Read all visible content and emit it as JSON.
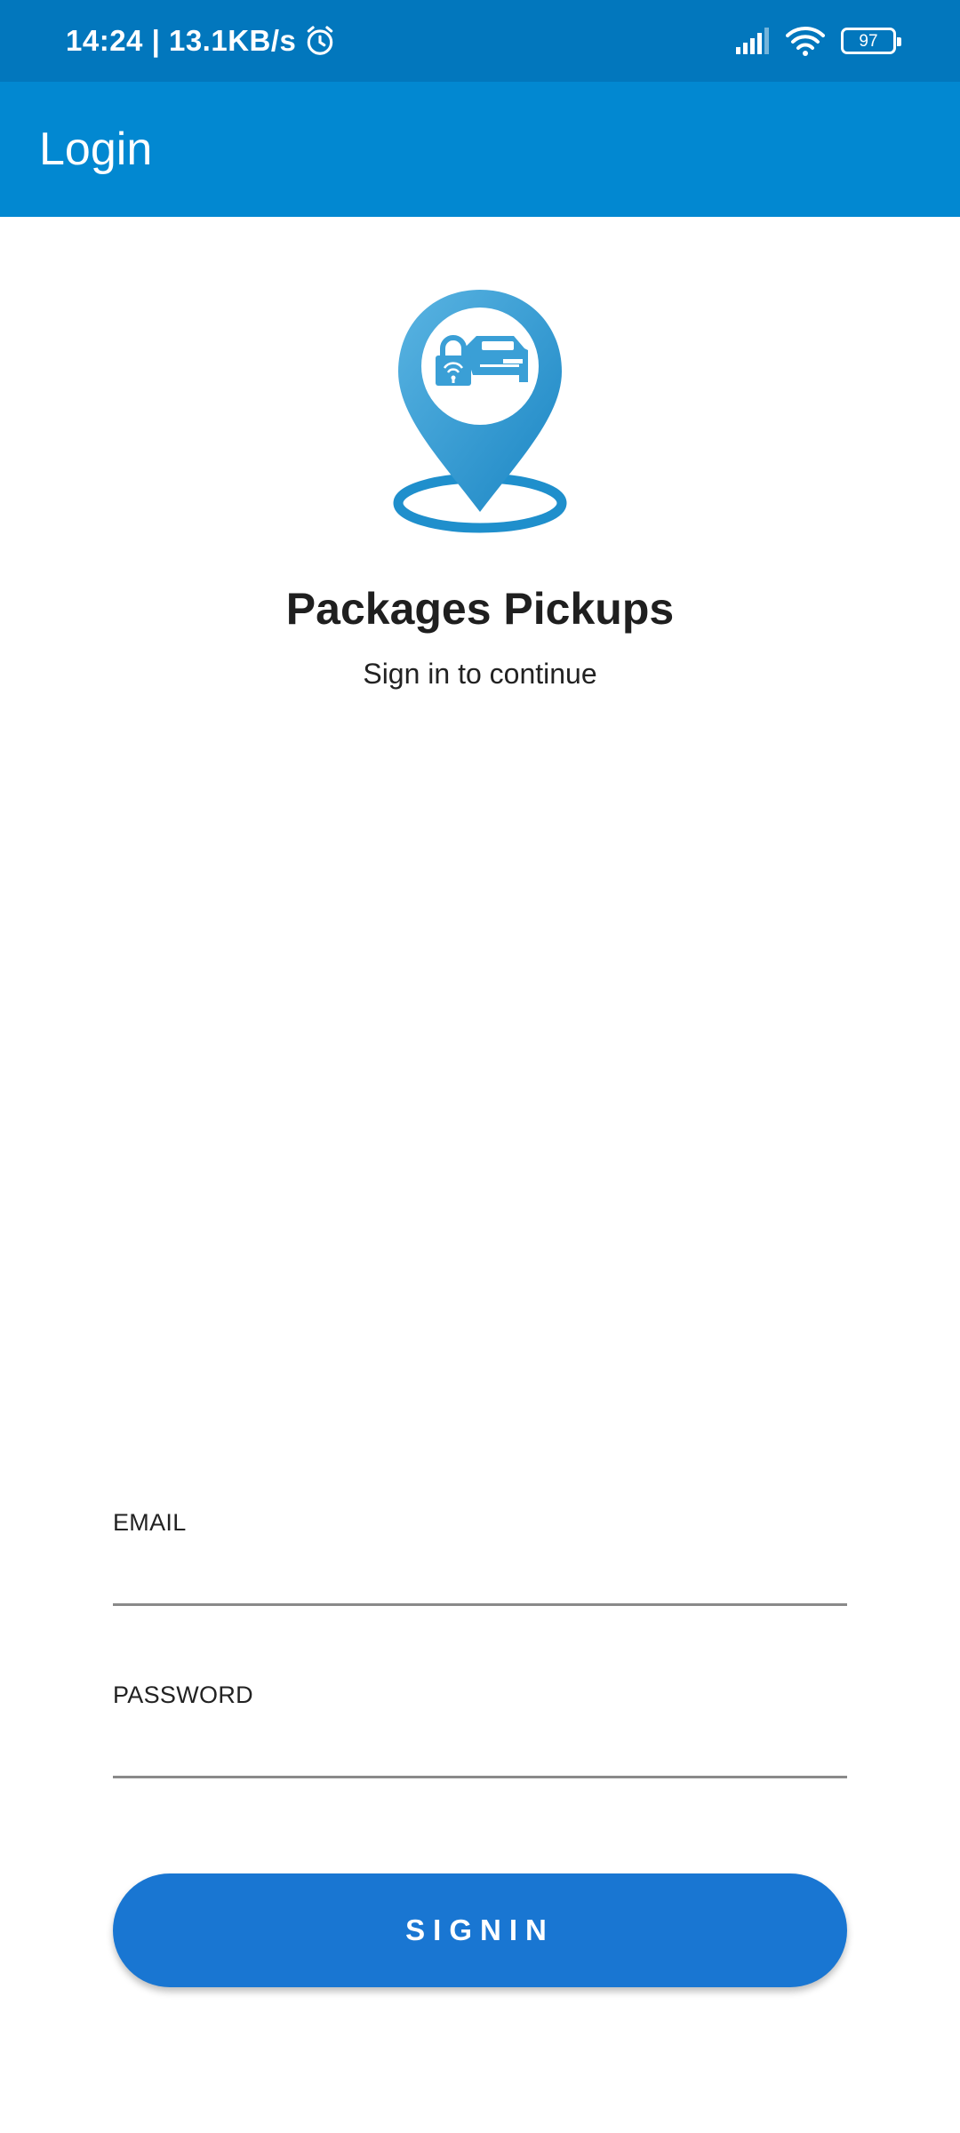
{
  "status_bar": {
    "time_speed": "14:24 | 13.1KB/s",
    "battery_level": "97",
    "icons": [
      "alarm-icon",
      "signal-icon",
      "wifi-icon",
      "battery-icon"
    ]
  },
  "app_bar": {
    "title": "Login"
  },
  "header": {
    "app_name": "Packages Pickups",
    "subtitle": "Sign in to continue",
    "logo_icon": "location-pin-car-lock-icon"
  },
  "form": {
    "email_label": "EMAIL",
    "email_value": "",
    "password_label": "PASSWORD",
    "password_value": "",
    "signin_label": "SIGNIN"
  },
  "colors": {
    "status_bar": "#0277bd",
    "app_bar": "#0288d1",
    "button": "#1976d2",
    "logo_blue": "#3a9fd6"
  }
}
